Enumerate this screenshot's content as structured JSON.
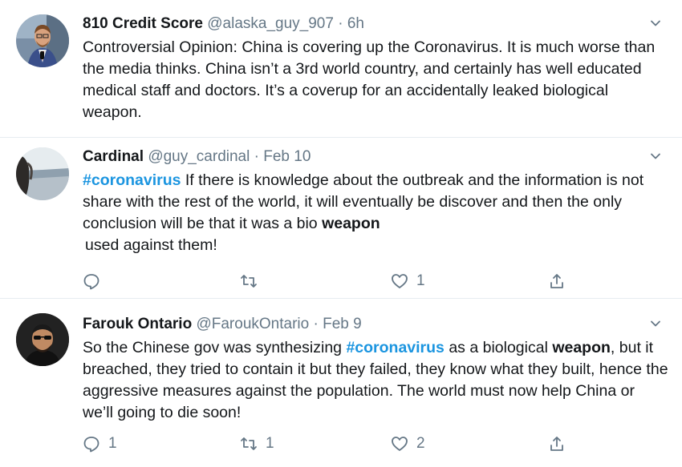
{
  "tweets": [
    {
      "name": "810 Credit Score",
      "handle": "@alaska_guy_907",
      "dot": "·",
      "time": "6h",
      "text": "Controversial Opinion: China is covering up the Coronavirus. It is much worse than the media thinks. China isn’t a 3rd world country, and certainly has well educated medical staff and doctors. It’s a coverup for an accidentally leaked biological weapon.",
      "avatar_icon": "man-with-microphone-avatar"
    },
    {
      "name": "Cardinal",
      "handle": "@guy_cardinal",
      "dot": "·",
      "time": "Feb 10",
      "hashtag": "#coronavirus",
      "text_a": " If there is knowledge about the outbreak and the information is not share with the rest of the world, it will eventually be discover and then the only conclusion will be that it was a bio ",
      "bold_word": "weapon",
      "text_b": "used against them!",
      "likes": "1",
      "avatar_icon": "landscape-avatar"
    },
    {
      "name": "Farouk Ontario",
      "handle": "@FaroukOntario",
      "dot": "·",
      "time": "Feb 9",
      "text_a": "So the Chinese gov was synthesizing ",
      "hashtag": "#coronavirus",
      "text_b": " as a biological ",
      "bold_word": "weapon",
      "text_c": ", but it breached, they tried to contain it but they failed, they know what they built, hence the aggressive measures against the population. The world must now help China or we’ll going to die soon!",
      "replies": "1",
      "retweets": "1",
      "likes": "2",
      "avatar_icon": "man-with-sunglasses-avatar"
    }
  ],
  "colors": {
    "link": "#1b95e0",
    "muted": "#657786",
    "text": "#14171a",
    "divider": "#e6ecf0"
  }
}
